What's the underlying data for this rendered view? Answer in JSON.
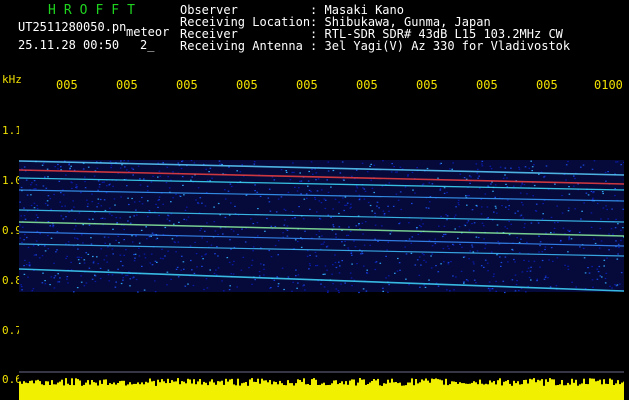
{
  "header": {
    "logo": "HROFFT",
    "filename": "UT2511280050.pn",
    "meteor_label": "meteor",
    "datetime": "25.11.28 00:50",
    "count": "2_",
    "info_rows": [
      {
        "key": "Observer          ",
        "value": ": Masaki Kano"
      },
      {
        "key": "Receiving Location",
        "value": ": Shibukawa, Gunma, Japan"
      },
      {
        "key": "Receiver          ",
        "value": ": RTL-SDR SDR# 43dB L15 103.2MHz CW"
      },
      {
        "key": "Receiving Antenna ",
        "value": ": 3el Yagi(V) Az 330 for Vladivostok"
      }
    ]
  },
  "time_axis": {
    "labels": [
      "005",
      "005",
      "005",
      "005",
      "005",
      "005",
      "005",
      "005",
      "005",
      "0100"
    ]
  },
  "freq_axis": {
    "unit": "kHz",
    "ticks": [
      "1.1",
      "1.0",
      "0.9",
      "0.8",
      "0.7",
      "0.6"
    ]
  },
  "colors": {
    "axis_text": "#f0e000",
    "logo": "#1fd41f",
    "signal_bar": "#f0f000",
    "background": "#000000"
  }
}
